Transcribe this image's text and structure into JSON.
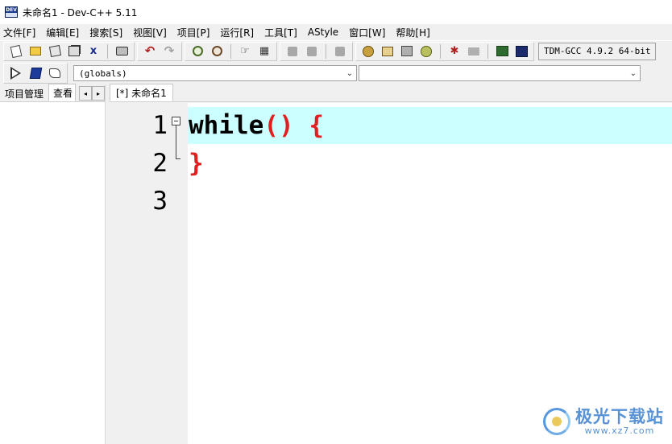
{
  "window": {
    "title": "未命名1 - Dev-C++ 5.11",
    "icon_text": "DEV"
  },
  "menu": [
    "文件[F]",
    "编辑[E]",
    "搜索[S]",
    "视图[V]",
    "项目[P]",
    "运行[R]",
    "工具[T]",
    "AStyle",
    "窗口[W]",
    "帮助[H]"
  ],
  "toolbar": {
    "icons": [
      "new-file-icon",
      "open-file-icon",
      "save-icon",
      "save-all-icon",
      "close-file-icon",
      "print-icon",
      "undo-icon",
      "redo-icon",
      "find-icon",
      "replace-icon",
      "goto-line-icon",
      "bookmark-icon",
      "compile-icon",
      "run-icon",
      "compile-run-icon",
      "rebuild-icon",
      "debug-icon",
      "stop-icon",
      "chart-icon",
      "console-icon"
    ],
    "compiler": "TDM-GCC 4.9.2 64-bit",
    "close_glyph": "x"
  },
  "toolbar2": {
    "globals_combo": "(globals)",
    "members_combo": "",
    "combo_arrow": "⌄"
  },
  "left_panel": {
    "tabs": [
      "项目管理",
      "查看"
    ],
    "arrows": [
      "◂",
      "▸"
    ]
  },
  "editor": {
    "tab_label": "[*] 未命名1",
    "line_numbers": [
      "1",
      "2",
      "3"
    ],
    "lines": [
      {
        "keyword": "while",
        "rest": "() {"
      },
      {
        "keyword": "",
        "rest": "}"
      },
      {
        "keyword": "",
        "rest": ""
      }
    ],
    "current_line_color": "#ccffff",
    "symbol_color": "#e02020"
  },
  "watermark": {
    "title": "极光下载站",
    "url": "www.xz7.com"
  }
}
